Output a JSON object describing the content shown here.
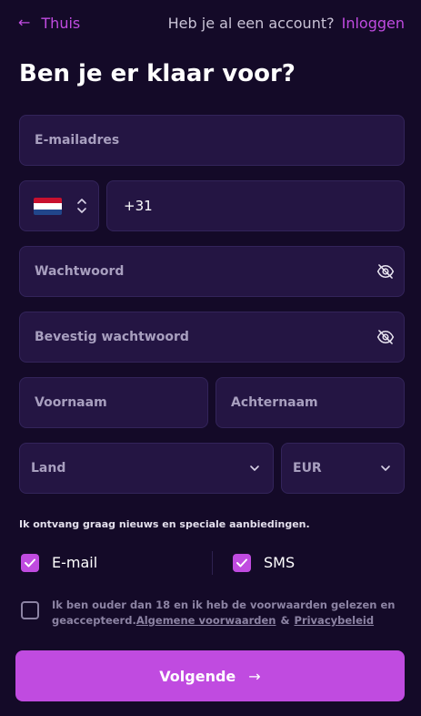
{
  "header": {
    "back_arrow": "←",
    "back_label": "Thuis",
    "account_question": "Heb je al een account?",
    "login_label": "Inloggen"
  },
  "title": "Ben je er klaar voor?",
  "form": {
    "email_placeholder": "E-mailadres",
    "phone_value": "+31",
    "password_placeholder": "Wachtwoord",
    "confirm_password_placeholder": "Bevestig wachtwoord",
    "firstname_placeholder": "Voornaam",
    "lastname_placeholder": "Achternaam",
    "country_placeholder": "Land",
    "currency_value": "EUR"
  },
  "icons": {
    "eye": "eye-off-icon",
    "chevron": "chevron-down-icon",
    "flag": "netherlands-flag-icon"
  },
  "newsletter": {
    "text": "Ik ontvang graag nieuws en speciale aanbiedingen.",
    "email_label": "E-mail",
    "email_checked": true,
    "sms_label": "SMS",
    "sms_checked": true
  },
  "terms": {
    "text": "Ik ben ouder dan 18 en ik heb de voorwaarden gelezen en geaccepteerd.",
    "link1": "Algemene voorwaarden",
    "amp": "&",
    "link2": "Privacybeleid",
    "checked": false
  },
  "submit": {
    "label": "Volgende",
    "arrow": "→"
  },
  "colors": {
    "background": "#140a28",
    "field": "#241543",
    "accent": "#c04be0"
  }
}
